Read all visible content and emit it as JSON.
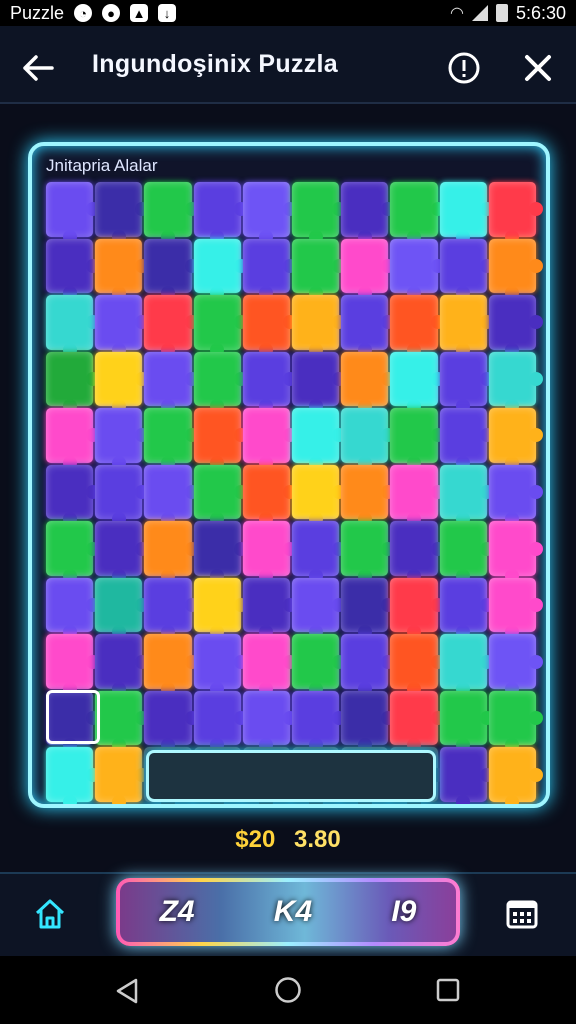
{
  "status_bar": {
    "app_label": "Puzzle",
    "time": "5:6:30",
    "icons": [
      "notification-icon",
      "record-icon",
      "media-icon",
      "download-icon",
      "wifi-icon",
      "signal-icon",
      "battery-icon"
    ]
  },
  "header": {
    "title": "Ingundoşinix Puzzla",
    "back_icon": "back-arrow-icon",
    "info_icon": "info-icon",
    "close_icon": "close-icon"
  },
  "board": {
    "label": "Jnitapria Alalar",
    "piece_colors": [
      "#6a4cf0",
      "#3b2da8",
      "#22c84a",
      "#5a3ee0",
      "#6e54f5",
      "#22c84a",
      "#4a2ec0",
      "#22c84a",
      "#36f0e8",
      "#ff3a4a",
      "#4a2ec0",
      "#ff8a1a",
      "#3b2da8",
      "#36f0e8",
      "#5a3ee0",
      "#22c84a",
      "#ff4acb",
      "#6e54f5",
      "#5a3ee0",
      "#ff8a1a",
      "#36d8d0",
      "#6a4cf0",
      "#ff3a4a",
      "#22c84a",
      "#ff5522",
      "#ffb21a",
      "#5a3ee0",
      "#ff5522",
      "#ffb21a",
      "#4a2ec0",
      "#22aa3a",
      "#ffd21a",
      "#6a4cf0",
      "#22c84a",
      "#5a3ee0",
      "#4a2ec0",
      "#ff8a1a",
      "#36f0e8",
      "#5a3ee0",
      "#36d8d0",
      "#ff4acb",
      "#6a4cf0",
      "#22c84a",
      "#ff5522",
      "#ff4acb",
      "#36f0e8",
      "#36d8d0",
      "#22c84a",
      "#5a3ee0",
      "#ffb21a",
      "#4a2ec0",
      "#5a3ee0",
      "#6a4cf0",
      "#22c84a",
      "#ff5522",
      "#ffd21a",
      "#ff8a1a",
      "#ff4acb",
      "#36d8d0",
      "#6a4cf0",
      "#22c84a",
      "#4a2ec0",
      "#ff8a1a",
      "#3b2da8",
      "#ff4acb",
      "#5a3ee0",
      "#22c84a",
      "#4a2ec0",
      "#22c84a",
      "#ff4acb",
      "#6a4cf0",
      "#1fb8a0",
      "#5a3ee0",
      "#ffd21a",
      "#4a2ec0",
      "#6a4cf0",
      "#3b2da8",
      "#ff3a4a",
      "#5a3ee0",
      "#ff4acb",
      "#ff4acb",
      "#4a2ec0",
      "#ff8a1a",
      "#6a4cf0",
      "#ff4acb",
      "#22c84a",
      "#5a3ee0",
      "#ff5522",
      "#36d8d0",
      "#6e54f5",
      "#3b2da8",
      "#22c84a",
      "#4a2ec0",
      "#5a3ee0",
      "#6a4cf0",
      "#5a3ee0",
      "#3b2da8",
      "#ff3a4a",
      "#22c84a",
      "#22c84a",
      "#36f0e8",
      "#ffb21a",
      "#1d3340",
      "#1d3340",
      "#1d3340",
      "#1d3340",
      "#1d3340",
      "#1d3340",
      "#4a2ec0",
      "#ffb21a"
    ]
  },
  "score": {
    "left": "$20",
    "right": "3.80"
  },
  "toolbar": {
    "home_icon": "home-icon",
    "calendar_icon": "calendar-icon",
    "buttons": [
      "Z4",
      "K4",
      "I9"
    ]
  },
  "navbar": {
    "back_icon": "nav-back-icon",
    "home_icon": "nav-home-icon",
    "recent_icon": "nav-recent-icon"
  }
}
